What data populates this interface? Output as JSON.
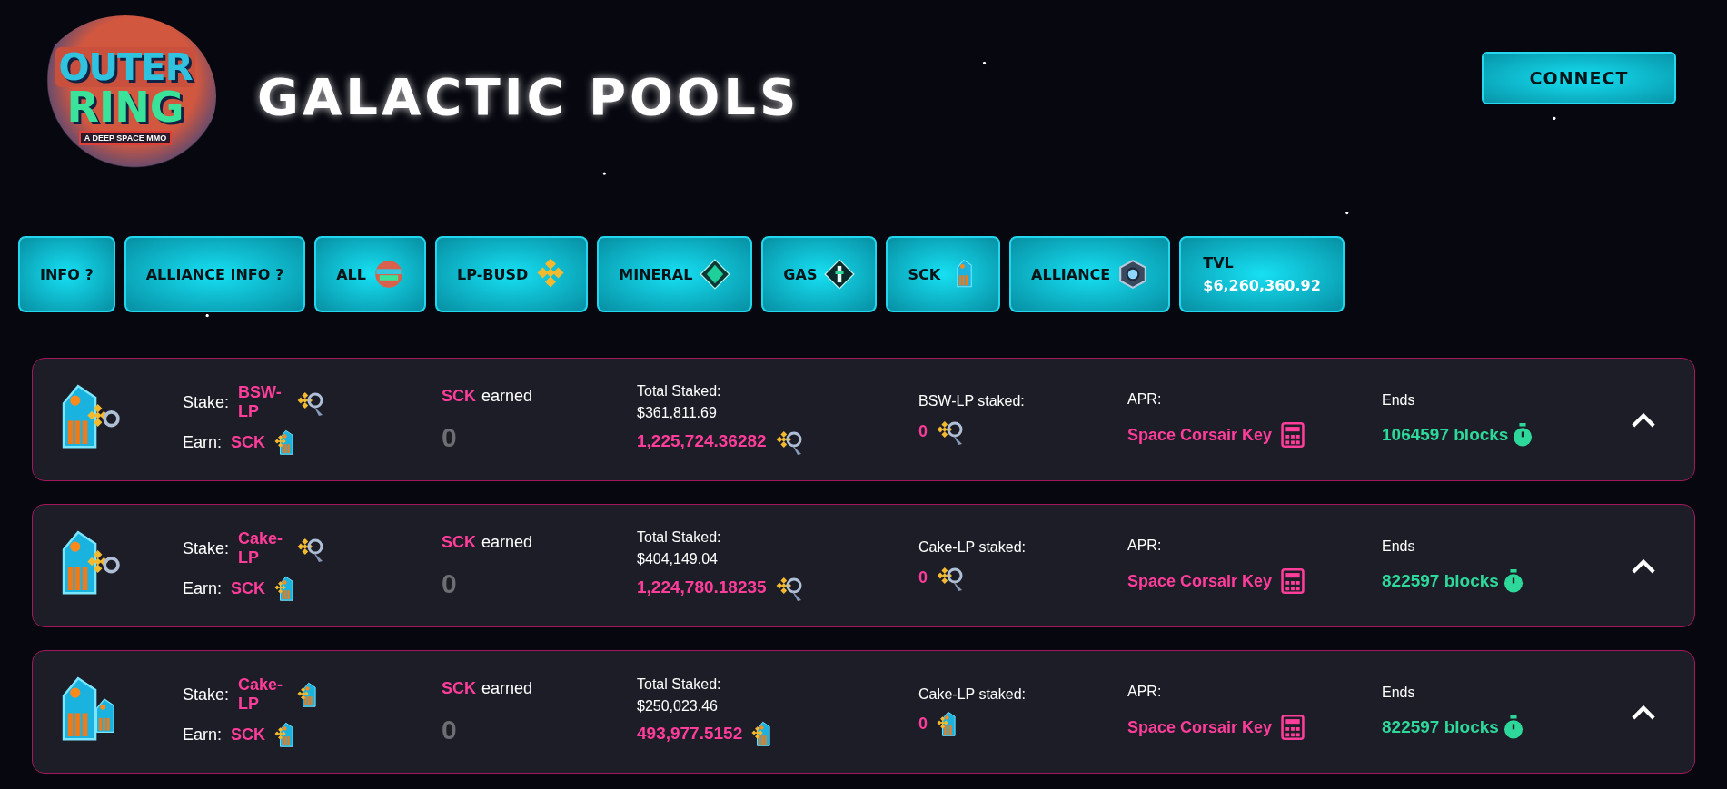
{
  "logo": {
    "line1": "OUTER",
    "line2": "RING",
    "tagline": "A DEEP SPACE MMO"
  },
  "title": "GALACTIC POOLS",
  "connect_button": "CONNECT",
  "tabs": [
    {
      "label": "INFO ?"
    },
    {
      "label": "ALLIANCE INFO ?"
    },
    {
      "label": "ALL"
    },
    {
      "label": "LP-BUSD"
    },
    {
      "label": "MINERAL"
    },
    {
      "label": "GAS"
    },
    {
      "label": "SCK"
    },
    {
      "label": "ALLIANCE"
    }
  ],
  "tvl": {
    "label": "TVL",
    "value": "$6,260,360.92"
  },
  "pools": [
    {
      "kind": "lp",
      "stake_label": "Stake:",
      "stake_token": "BSW-LP",
      "earn_label": "Earn:",
      "earn_token": "SCK",
      "earned_token": "SCK",
      "earned_label": "earned",
      "earned": "0",
      "total_label": "Total Staked:",
      "total_usd": "$361,811.69",
      "total_tokens": "1,225,724.36282",
      "staked_label": "BSW-LP staked:",
      "staked": "0",
      "apr_label": "APR:",
      "apr": "Space Corsair Key",
      "ends_label": "Ends",
      "ends": "1064597 blocks"
    },
    {
      "kind": "lp",
      "stake_label": "Stake:",
      "stake_token": "Cake-LP",
      "earn_label": "Earn:",
      "earn_token": "SCK",
      "earned_token": "SCK",
      "earned_label": "earned",
      "earned": "0",
      "total_label": "Total Staked:",
      "total_usd": "$404,149.04",
      "total_tokens": "1,224,780.18235",
      "staked_label": "Cake-LP staked:",
      "staked": "0",
      "apr_label": "APR:",
      "apr": "Space Corsair Key",
      "ends_label": "Ends",
      "ends": "822597 blocks"
    },
    {
      "kind": "keycard",
      "stake_label": "Stake:",
      "stake_token": "Cake-LP",
      "earn_label": "Earn:",
      "earn_token": "SCK",
      "earned_token": "SCK",
      "earned_label": "earned",
      "earned": "0",
      "total_label": "Total Staked:",
      "total_usd": "$250,023.46",
      "total_tokens": "493,977.5152",
      "staked_label": "Cake-LP staked:",
      "staked": "0",
      "apr_label": "APR:",
      "apr": "Space Corsair Key",
      "ends_label": "Ends",
      "ends": "822597 blocks"
    }
  ]
}
